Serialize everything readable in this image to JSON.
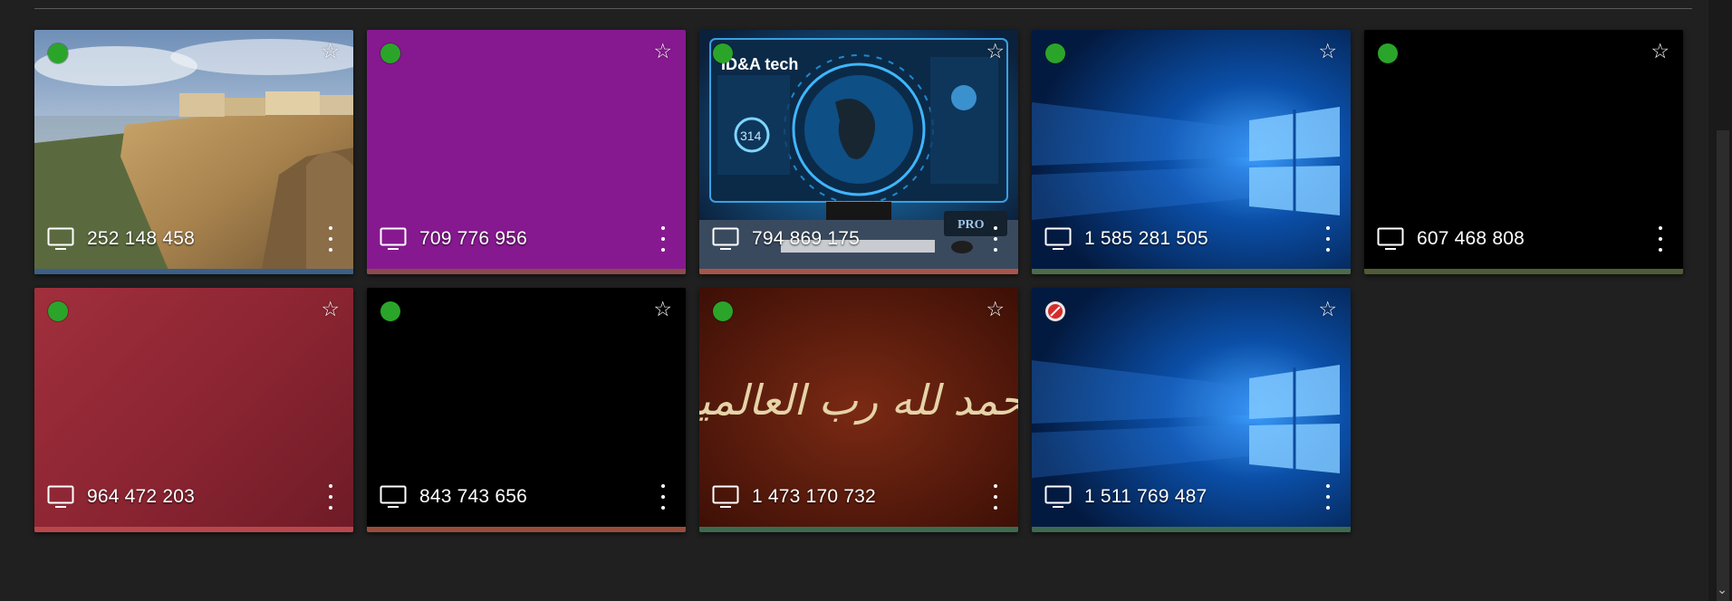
{
  "tiles": [
    {
      "id": "252 148 458",
      "status": "online",
      "accent": "#3a5f88",
      "bg": "cliff"
    },
    {
      "id": "709 776 956",
      "status": "online",
      "accent": "#8b4b4b",
      "bg": "purple"
    },
    {
      "id": "794 869 175",
      "status": "online",
      "accent": "#a9544a",
      "bg": "tech"
    },
    {
      "id": "1 585 281 505",
      "status": "online",
      "accent": "#4d6b48",
      "bg": "windows"
    },
    {
      "id": "607 468 808",
      "status": "online",
      "accent": "#505c34",
      "bg": "black"
    },
    {
      "id": "964 472 203",
      "status": "online",
      "accent": "#b8474a",
      "bg": "red"
    },
    {
      "id": "843 743 656",
      "status": "online",
      "accent": "#9a4c3a",
      "bg": "black"
    },
    {
      "id": "1 473 170 732",
      "status": "online",
      "accent": "#3d6a4f",
      "bg": "calligraphy"
    },
    {
      "id": "1 511 769 487",
      "status": "blocked",
      "accent": "#3d6a4f",
      "bg": "windows"
    }
  ],
  "icons": {
    "favorite": "star-outline-icon",
    "device": "monitor-icon",
    "menu": "more-vertical-icon",
    "status_online": "green-dot-icon",
    "status_blocked": "blocked-icon"
  },
  "artwork": {
    "tech_title": "ID&A tech",
    "tech_metric": "314",
    "tech_badge": "PRO",
    "calligraphy_text": "الحمد لله رب العالمين"
  }
}
